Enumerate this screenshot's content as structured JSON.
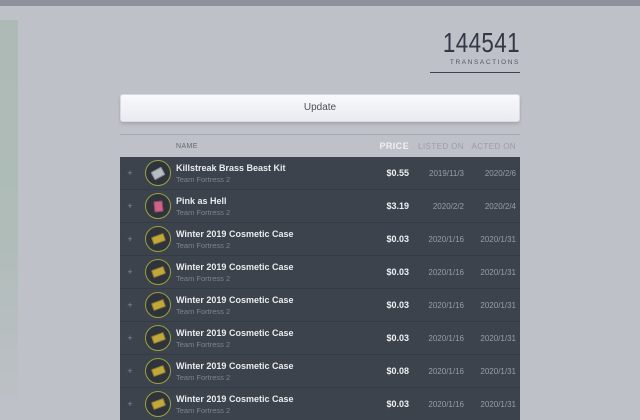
{
  "stats": {
    "count": "144541",
    "label": "TRANSACTIONS"
  },
  "update_button": {
    "label": "Update"
  },
  "table": {
    "columns": [
      "NAME",
      "PRICE",
      "LISTED ON",
      "ACTED ON"
    ],
    "expand_symbol": "+",
    "rows": [
      {
        "name": "Killstreak Brass Beast Kit",
        "game": "Team Fortress 2",
        "price": "$0.55",
        "listed": "2019/11/3",
        "acted": "2020/2/6",
        "icon": {
          "name": "killstreak-kit-icon",
          "color": "#b7bdc4",
          "ring": "#9aa23e"
        }
      },
      {
        "name": "Pink as Hell",
        "game": "Team Fortress 2",
        "price": "$3.19",
        "listed": "2020/2/2",
        "acted": "2020/2/4",
        "icon": {
          "name": "paint-can-icon",
          "color": "#d06288",
          "ring": "#9aa23e"
        }
      },
      {
        "name": "Winter 2019 Cosmetic Case",
        "game": "Team Fortress 2",
        "price": "$0.03",
        "listed": "2020/1/16",
        "acted": "2020/1/31",
        "icon": {
          "name": "crate-icon",
          "color": "#c2a83b",
          "ring": "#99a13e"
        }
      },
      {
        "name": "Winter 2019 Cosmetic Case",
        "game": "Team Fortress 2",
        "price": "$0.03",
        "listed": "2020/1/16",
        "acted": "2020/1/31",
        "icon": {
          "name": "crate-icon",
          "color": "#c2a83b",
          "ring": "#99a13e"
        }
      },
      {
        "name": "Winter 2019 Cosmetic Case",
        "game": "Team Fortress 2",
        "price": "$0.03",
        "listed": "2020/1/16",
        "acted": "2020/1/31",
        "icon": {
          "name": "crate-icon",
          "color": "#c2a83b",
          "ring": "#99a13e"
        }
      },
      {
        "name": "Winter 2019 Cosmetic Case",
        "game": "Team Fortress 2",
        "price": "$0.03",
        "listed": "2020/1/16",
        "acted": "2020/1/31",
        "icon": {
          "name": "crate-icon",
          "color": "#c2a83b",
          "ring": "#99a13e"
        }
      },
      {
        "name": "Winter 2019 Cosmetic Case",
        "game": "Team Fortress 2",
        "price": "$0.08",
        "listed": "2020/1/16",
        "acted": "2020/1/31",
        "icon": {
          "name": "crate-icon",
          "color": "#c2a83b",
          "ring": "#99a13e"
        }
      },
      {
        "name": "Winter 2019 Cosmetic Case",
        "game": "Team Fortress 2",
        "price": "$0.03",
        "listed": "2020/1/16",
        "acted": "2020/1/31",
        "icon": {
          "name": "crate-icon",
          "color": "#c2a83b",
          "ring": "#99a13e"
        }
      }
    ]
  },
  "colors": {
    "page_background": "#bfc1c9",
    "top_bar": "#8e909b",
    "left_strip": "#adbab6",
    "table_background": "#3d434d",
    "icon_ring_olive": "#99a13e",
    "stat_number": "#333845"
  }
}
